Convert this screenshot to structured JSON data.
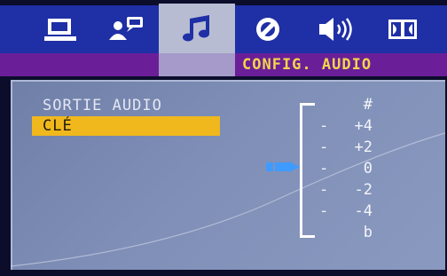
{
  "tabs": [
    {
      "icon": "monitor-icon",
      "active": false
    },
    {
      "icon": "user-speech-icon",
      "active": false
    },
    {
      "icon": "music-note-icon",
      "active": true
    },
    {
      "icon": "circle-slash-icon",
      "active": false
    },
    {
      "icon": "speaker-icon",
      "active": false
    },
    {
      "icon": "dolby-icon",
      "active": false
    }
  ],
  "header": {
    "title": "CONFIG. AUDIO"
  },
  "menu": {
    "items": [
      {
        "label": "SORTIE AUDIO",
        "selected": false
      },
      {
        "label": "CLÉ",
        "selected": true
      }
    ]
  },
  "key_scale": {
    "labels": [
      "#",
      "+4",
      "+2",
      "0",
      "-2",
      "-4",
      "b"
    ],
    "dash": "-",
    "current": "0"
  },
  "colors": {
    "tab_bar": "#1f2fa5",
    "header_band": "#6a1f98",
    "header_text": "#f3d54b",
    "highlight": "#f0b81d",
    "pointer": "#3f9bff"
  }
}
